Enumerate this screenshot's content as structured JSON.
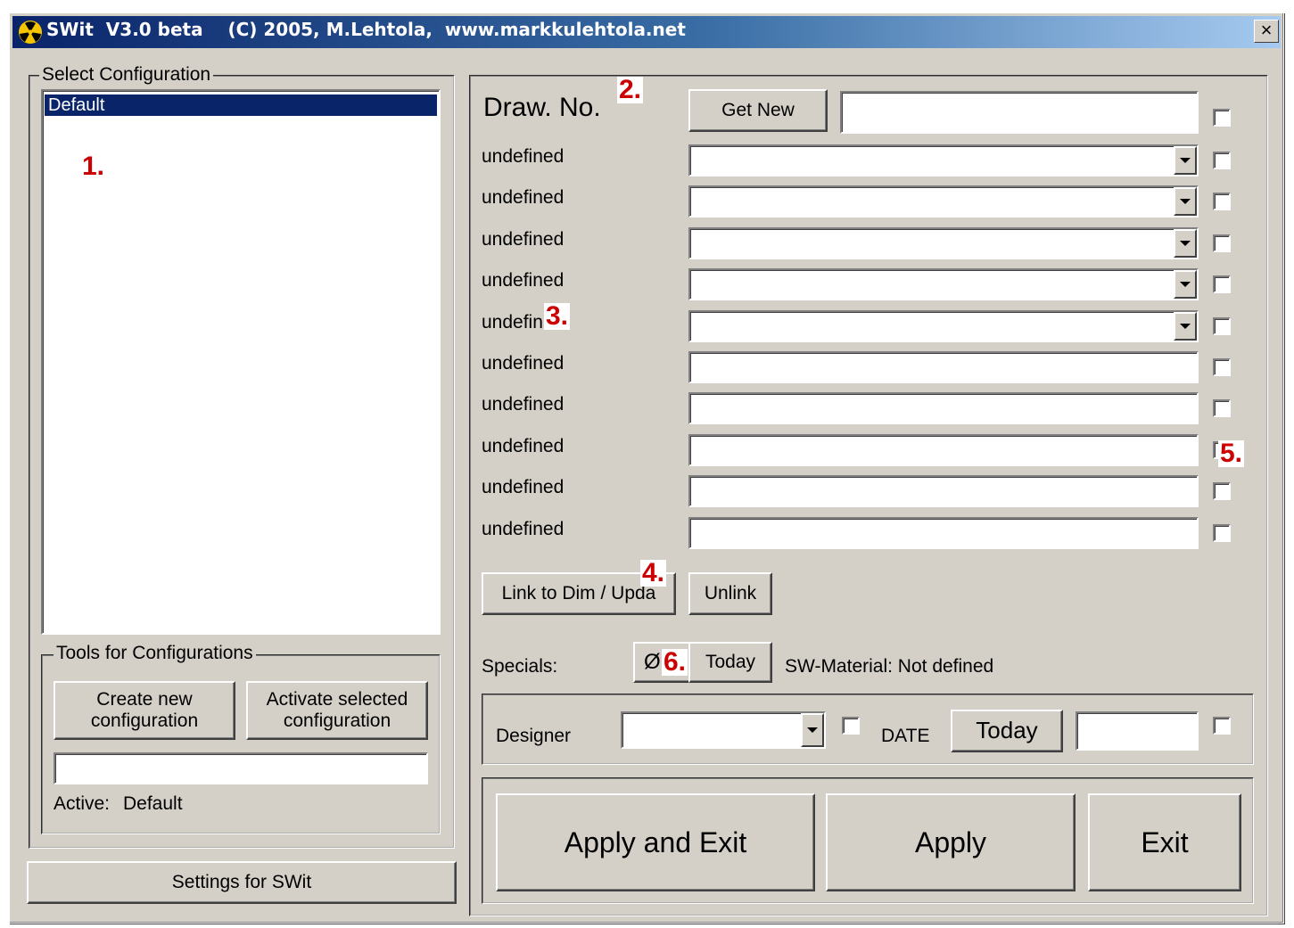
{
  "window": {
    "title": "SWit  V3.0 beta    (C) 2005, M.Lehtola,  www.markkulehtola.net",
    "close": "×"
  },
  "left": {
    "select_config_legend": "Select Configuration",
    "configs": [
      "Default"
    ],
    "tools_legend": "Tools for Configurations",
    "create_btn": "Create new configuration",
    "activate_btn": "Activate selected configuration",
    "config_name_value": "",
    "active_label": "Active:",
    "active_value": "Default",
    "settings_btn": "Settings for SWit"
  },
  "right": {
    "drawno_label": "Draw. No.",
    "get_new_btn": "Get New",
    "drawno_value": "",
    "fields": [
      {
        "label": "undefined",
        "type": "combo",
        "value": ""
      },
      {
        "label": "undefined",
        "type": "combo",
        "value": ""
      },
      {
        "label": "undefined",
        "type": "combo",
        "value": ""
      },
      {
        "label": "undefined",
        "type": "combo",
        "value": ""
      },
      {
        "label": "undefin",
        "type": "combo",
        "value": ""
      },
      {
        "label": "undefined",
        "type": "text",
        "value": ""
      },
      {
        "label": "undefined",
        "type": "text",
        "value": ""
      },
      {
        "label": "undefined",
        "type": "text",
        "value": ""
      },
      {
        "label": "undefined",
        "type": "text",
        "value": ""
      },
      {
        "label": "undefined",
        "type": "text",
        "value": ""
      }
    ],
    "link_btn": "Link to Dim / Upda",
    "unlink_btn": "Unlink",
    "specials_label": "Specials:",
    "diameter_btn": "Ø",
    "today_btn": "Today",
    "material_text": "SW-Material: Not defined",
    "designer_label": "Designer",
    "designer_value": "",
    "date_label": "DATE",
    "date_today_btn": "Today",
    "date_value": "",
    "apply_exit_btn": "Apply and Exit",
    "apply_btn": "Apply",
    "exit_btn": "Exit"
  },
  "annotations": [
    "1.",
    "2.",
    "3.",
    "4.",
    "5.",
    "6."
  ]
}
